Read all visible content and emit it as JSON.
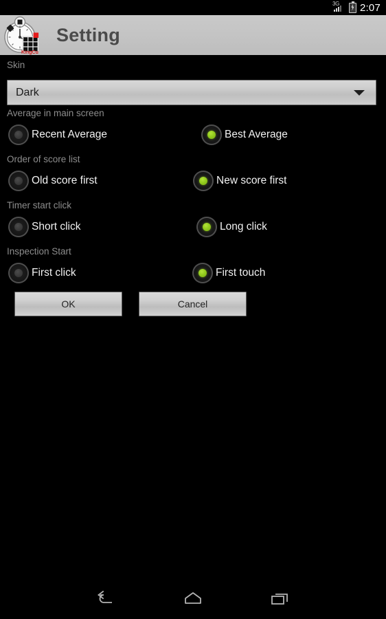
{
  "status_bar": {
    "network_type": "3G",
    "signal_icon": "signal-bars-icon",
    "battery_icon": "battery-charging-icon",
    "time": "2:07"
  },
  "action_bar": {
    "app_icon": "stopwatch-cube-icon",
    "title": "Setting"
  },
  "settings": {
    "skin": {
      "label": "Skin",
      "selected": "Dark",
      "dropdown_icon": "chevron-down-icon"
    },
    "groups": [
      {
        "label": "Average in main screen",
        "options": [
          {
            "label": "Recent Average",
            "checked": false
          },
          {
            "label": "Best Average",
            "checked": true
          }
        ]
      },
      {
        "label": "Order of score list",
        "options": [
          {
            "label": "Old score first",
            "checked": false
          },
          {
            "label": "New score first",
            "checked": true
          }
        ]
      },
      {
        "label": "Timer start click",
        "options": [
          {
            "label": "Short click",
            "checked": false
          },
          {
            "label": "Long click",
            "checked": true
          }
        ]
      },
      {
        "label": "Inspection Start",
        "options": [
          {
            "label": "First click",
            "checked": false
          },
          {
            "label": "First touch",
            "checked": true
          }
        ]
      }
    ],
    "buttons": {
      "ok": "OK",
      "cancel": "Cancel"
    }
  },
  "nav_bar": {
    "back": "back-icon",
    "home": "home-icon",
    "recents": "recent-apps-icon"
  },
  "colors": {
    "accent_green": "#93cc1e",
    "background": "#000000",
    "action_bar": "#c4c4c4",
    "section_label": "#8d8d8d"
  }
}
